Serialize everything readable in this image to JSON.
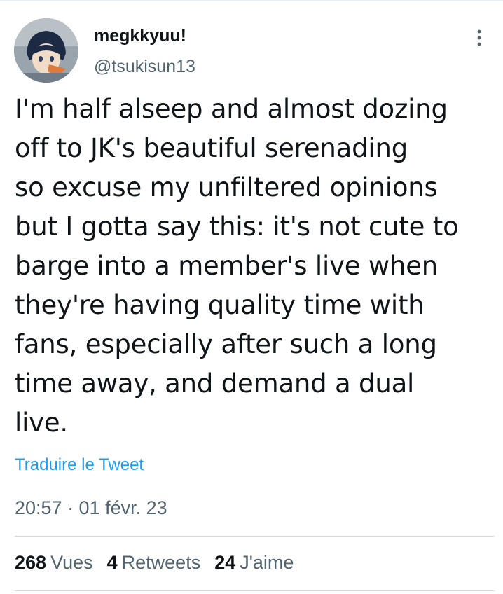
{
  "author": {
    "name": "megkkyuu!",
    "handle": "@tsukisun13",
    "avatar_icon": "anime-avatar"
  },
  "tweet": {
    "lines": [
      "I'm half alseep and almost dozing",
      "off to JK's beautiful serenading",
      "so excuse my unfiltered opinions",
      "but I gotta say this: it's not cute to",
      "barge into a member's live when",
      "they're having quality time with",
      "fans, especially after such a long",
      "time away, and demand a dual",
      "live."
    ]
  },
  "translate_label": "Traduire le Tweet",
  "timestamp": "20:57 · 01 févr. 23",
  "stats": {
    "views_count": "268",
    "views_label": "Vues",
    "retweets_count": "4",
    "retweets_label": "Retweets",
    "likes_count": "24",
    "likes_label": "J'aime"
  },
  "colors": {
    "text": "#0f1419",
    "secondary": "#536471",
    "link": "#1d9bf0",
    "divider": "#cfd9de"
  },
  "more_icon": "more-vertical-icon"
}
